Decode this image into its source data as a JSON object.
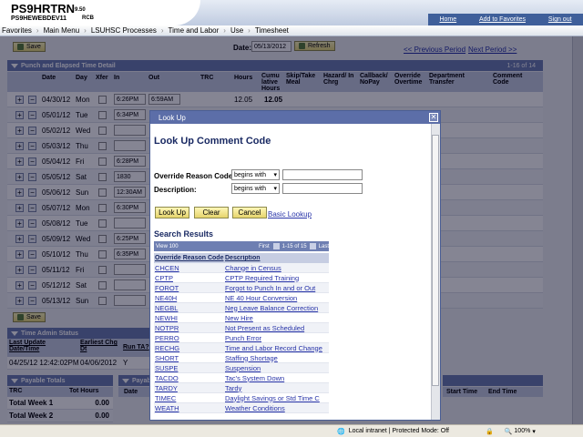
{
  "header": {
    "system_name": "PS9HRTRN",
    "system_version": "9.50",
    "database": "PS9HEWEBDEV11",
    "user_code": "RCB",
    "links": [
      "Home",
      "Add to Favorites",
      "Sign out"
    ]
  },
  "breadcrumb": [
    "Favorites",
    "Main Menu",
    "LSUHSC Processes",
    "Time and Labor",
    "Use",
    "Timesheet"
  ],
  "toolbar": {
    "save_label": "Save",
    "date_label": "Date:",
    "date_value": "05/13/2012",
    "refresh_label": "Refresh",
    "prev_period": "<< Previous Period",
    "next_period": "Next Period >>"
  },
  "timesheet": {
    "section_title": "Punch and Elapsed Time Detail",
    "page_count": "1-16 of 14",
    "columns": [
      "Date",
      "Day",
      "Xfer",
      "In",
      "Out",
      "TRC",
      "Hours",
      "Cumu lative Hours",
      "Skip/Take Meal",
      "Hazard/ In Chrg",
      "Callback/ NoPay",
      "Override Overtime",
      "Department Transfer",
      "Comment Code"
    ],
    "rows": [
      {
        "date": "04/30/12",
        "day": "Mon",
        "in": "6:26PM",
        "out": "6:59AM",
        "hours": "12.05",
        "cumulative": "12.05"
      },
      {
        "date": "05/01/12",
        "day": "Tue",
        "in": "6:34PM",
        "out": "",
        "hours": "",
        "cumulative": ""
      },
      {
        "date": "05/02/12",
        "day": "Wed",
        "in": "",
        "out": "",
        "hours": "",
        "cumulative": ""
      },
      {
        "date": "05/03/12",
        "day": "Thu",
        "in": "",
        "out": "",
        "hours": "",
        "cumulative": ""
      },
      {
        "date": "05/04/12",
        "day": "Fri",
        "in": "6:28PM",
        "out": "",
        "hours": "",
        "cumulative": ""
      },
      {
        "date": "05/05/12",
        "day": "Sat",
        "in": "1830",
        "out": "",
        "hours": "",
        "cumulative": ""
      },
      {
        "date": "05/06/12",
        "day": "Sun",
        "in": "12:30AM",
        "out": "",
        "hours": "",
        "cumulative": ""
      },
      {
        "date": "05/07/12",
        "day": "Mon",
        "in": "6:30PM",
        "out": "",
        "hours": "",
        "cumulative": ""
      },
      {
        "date": "05/08/12",
        "day": "Tue",
        "in": "",
        "out": "",
        "hours": "",
        "cumulative": ""
      },
      {
        "date": "05/09/12",
        "day": "Wed",
        "in": "6:25PM",
        "out": "",
        "hours": "",
        "cumulative": ""
      },
      {
        "date": "05/10/12",
        "day": "Thu",
        "in": "6:35PM",
        "out": "",
        "hours": "",
        "cumulative": ""
      },
      {
        "date": "05/11/12",
        "day": "Fri",
        "in": "",
        "out": "",
        "hours": "",
        "cumulative": ""
      },
      {
        "date": "05/12/12",
        "day": "Sat",
        "in": "",
        "out": "",
        "hours": "",
        "cumulative": ""
      },
      {
        "date": "05/13/12",
        "day": "Sun",
        "in": "",
        "out": "",
        "hours": "",
        "cumulative": ""
      }
    ]
  },
  "bottom_save_label": "Save",
  "time_admin": {
    "title": "Time Admin Status",
    "col1": "Last Update Date/Time",
    "col2": "Earliest Chg Dt",
    "col3": "Run TA?",
    "val1": "04/25/12 12:42:02PM",
    "val2": "04/06/2012",
    "val3": "Y"
  },
  "payable_totals": {
    "title": "Payable Totals",
    "col1": "TRC",
    "col2": "Tot Hours",
    "rows": [
      {
        "label": "Total Week 1",
        "value": "0.00"
      },
      {
        "label": "Total Week 2",
        "value": "0.00"
      }
    ],
    "payable_title": "Payab",
    "date_col": "Date",
    "start_time": "Start Time",
    "end_time": "End Time"
  },
  "modal": {
    "title": "Look Up",
    "close": "✕",
    "heading": "Look Up Comment Code",
    "field1_label": "Override Reason Code:",
    "field1_op": "begins with",
    "field2_label": "Description:",
    "field2_op": "begins with",
    "lookup_btn": "Look Up",
    "clear_btn": "Clear",
    "cancel_btn": "Cancel",
    "basic_lookup": "Basic Lookup",
    "results_title": "Search Results",
    "view_100": "View 100",
    "first": "First",
    "range": "1-15 of 15",
    "last": "Last",
    "col_code": "Override Reason Code",
    "col_desc": "Description",
    "results": [
      {
        "code": "CHCEN",
        "desc": "Change in Census"
      },
      {
        "code": "CPTP",
        "desc": "CPTP Required Training"
      },
      {
        "code": "FOROT",
        "desc": "Forgot to Punch In and or Out"
      },
      {
        "code": "NE40H",
        "desc": "NE 40 Hour Conversion"
      },
      {
        "code": "NEGBL",
        "desc": "Neg Leave Balance Correction"
      },
      {
        "code": "NEWHI",
        "desc": "New Hire"
      },
      {
        "code": "NOTPR",
        "desc": "Not Present as Scheduled"
      },
      {
        "code": "PERRO",
        "desc": "Punch Error"
      },
      {
        "code": "RECHG",
        "desc": "Time and Labor Record Change"
      },
      {
        "code": "SHORT",
        "desc": "Staffing Shortage"
      },
      {
        "code": "SUSPE",
        "desc": "Suspension"
      },
      {
        "code": "TACDO",
        "desc": "Tac's System Down"
      },
      {
        "code": "TARDY",
        "desc": "Tardy"
      },
      {
        "code": "TIMEC",
        "desc": "Daylight Savings or Std Time C"
      },
      {
        "code": "WEATH",
        "desc": "Weather Conditions"
      }
    ]
  },
  "statusbar": {
    "zone": "Local intranet | Protected Mode: Off",
    "zoom": "100%"
  },
  "colors": {
    "accent": "#6e7fb2",
    "button": "#e6d46c",
    "link": "#2733a8"
  }
}
